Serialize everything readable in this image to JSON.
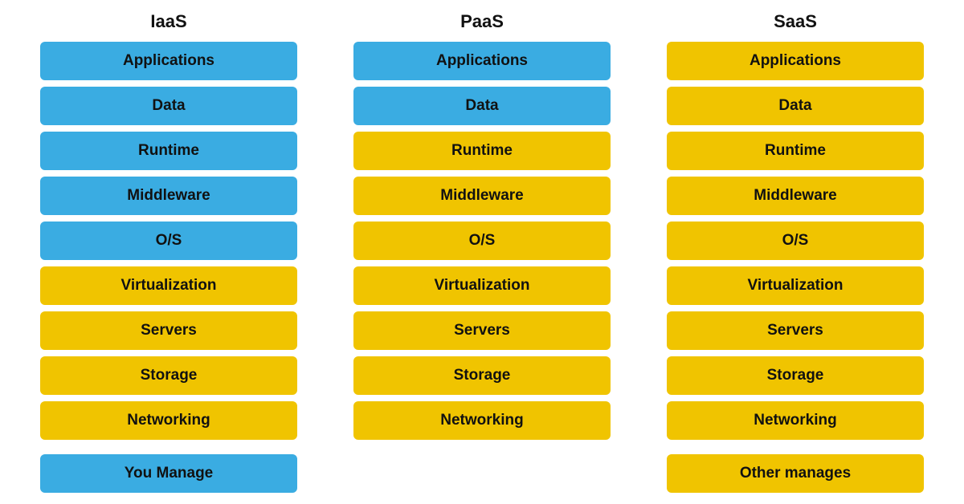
{
  "headers": {
    "iaas": "IaaS",
    "paas": "PaaS",
    "saas": "SaaS"
  },
  "rows": [
    {
      "label": "Applications",
      "iaas": "blue",
      "paas": "blue",
      "saas": "yellow"
    },
    {
      "label": "Data",
      "iaas": "blue",
      "paas": "blue",
      "saas": "yellow"
    },
    {
      "label": "Runtime",
      "iaas": "blue",
      "paas": "yellow",
      "saas": "yellow"
    },
    {
      "label": "Middleware",
      "iaas": "blue",
      "paas": "yellow",
      "saas": "yellow"
    },
    {
      "label": "O/S",
      "iaas": "blue",
      "paas": "yellow",
      "saas": "yellow"
    },
    {
      "label": "Virtualization",
      "iaas": "yellow",
      "paas": "yellow",
      "saas": "yellow"
    },
    {
      "label": "Servers",
      "iaas": "yellow",
      "paas": "yellow",
      "saas": "yellow"
    },
    {
      "label": "Storage",
      "iaas": "yellow",
      "paas": "yellow",
      "saas": "yellow"
    },
    {
      "label": "Networking",
      "iaas": "yellow",
      "paas": "yellow",
      "saas": "yellow"
    }
  ],
  "legend": {
    "iaas_label": "You Manage",
    "iaas_color": "blue",
    "saas_label": "Other manages",
    "saas_color": "yellow"
  }
}
